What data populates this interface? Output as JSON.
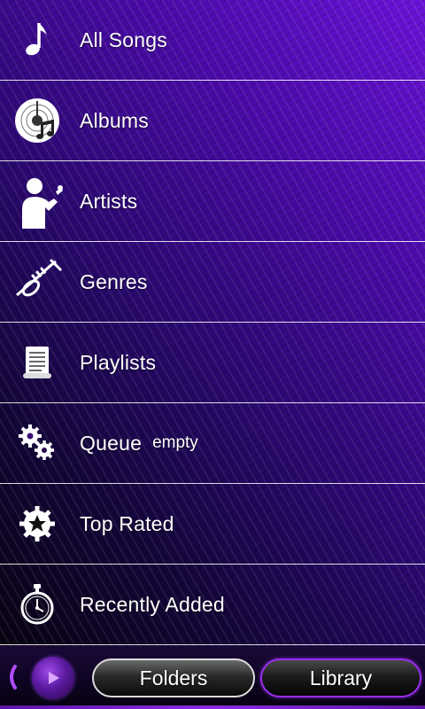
{
  "menu": {
    "items": [
      {
        "label": "All Songs",
        "sublabel": "",
        "icon": "music-note-icon"
      },
      {
        "label": "Albums",
        "sublabel": "",
        "icon": "album-disc-icon"
      },
      {
        "label": "Artists",
        "sublabel": "",
        "icon": "singer-icon"
      },
      {
        "label": "Genres",
        "sublabel": "",
        "icon": "trumpet-icon"
      },
      {
        "label": "Playlists",
        "sublabel": "",
        "icon": "scroll-list-icon"
      },
      {
        "label": "Queue",
        "sublabel": "empty",
        "icon": "gears-icon"
      },
      {
        "label": "Top Rated",
        "sublabel": "",
        "icon": "star-badge-icon"
      },
      {
        "label": "Recently Added",
        "sublabel": "",
        "icon": "stopwatch-icon"
      }
    ]
  },
  "bottom_bar": {
    "folders_label": "Folders",
    "library_label": "Library",
    "back_icon": "chevron-left-icon",
    "play_icon": "play-icon",
    "active_tab": "Library"
  },
  "colors": {
    "accent": "#9a2ef0",
    "background_top": "#6a12d8",
    "background_bottom": "#050208"
  }
}
